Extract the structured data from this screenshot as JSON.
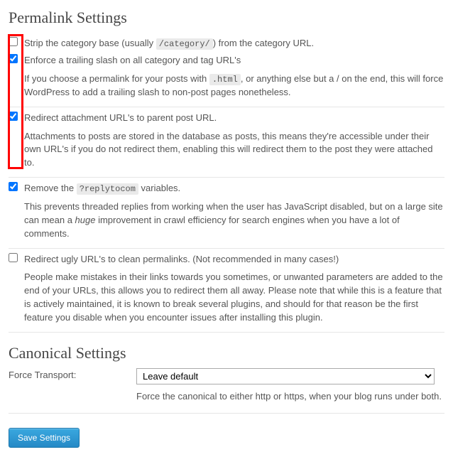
{
  "headings": {
    "permalink": "Permalink Settings",
    "canonical": "Canonical Settings"
  },
  "options": {
    "strip_cat": {
      "checked": false,
      "label_pre": "Strip the category base (usually ",
      "label_code": "/category/",
      "label_post": ") from the category URL."
    },
    "trailing_slash": {
      "checked": true,
      "label": "Enforce a trailing slash on all category and tag URL's",
      "desc_pre": "If you choose a permalink for your posts with ",
      "desc_code": ".html",
      "desc_post": ", or anything else but a / on the end, this will force WordPress to add a trailing slash to non-post pages nonetheless."
    },
    "redirect_attach": {
      "checked": true,
      "label": "Redirect attachment URL's to parent post URL.",
      "desc": "Attachments to posts are stored in the database as posts, this means they're accessible under their own URL's if you do not redirect them, enabling this will redirect them to the post they were attached to."
    },
    "remove_replytocom": {
      "checked": true,
      "label_pre": "Remove the ",
      "label_code": "?replytocom",
      "label_post": " variables.",
      "desc_pre": "This prevents threaded replies from working when the user has JavaScript disabled, but on a large site can mean a ",
      "desc_em": "huge",
      "desc_post": " improvement in crawl efficiency for search engines when you have a lot of comments."
    },
    "redirect_ugly": {
      "checked": false,
      "label": "Redirect ugly URL's to clean permalinks. (Not recommended in many cases!)",
      "desc": "People make mistakes in their links towards you sometimes, or unwanted parameters are added to the end of your URLs, this allows you to redirect them all away. Please note that while this is a feature that is actively maintained, it is known to break several plugins, and should for that reason be the first feature you disable when you encounter issues after installing this plugin."
    }
  },
  "canonical": {
    "label": "Force Transport:",
    "selected": "Leave default",
    "desc": "Force the canonical to either http or https, when your blog runs under both."
  },
  "buttons": {
    "save": "Save Settings"
  }
}
